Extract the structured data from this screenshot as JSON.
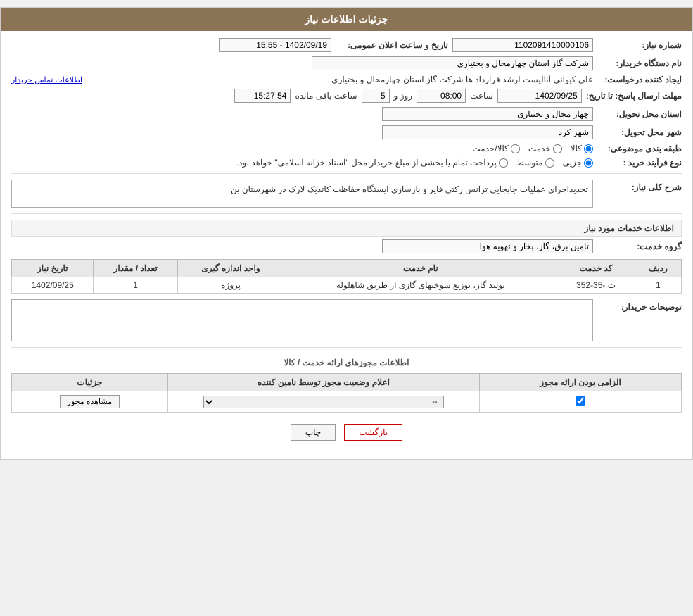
{
  "header": {
    "title": "جزئیات اطلاعات نیاز"
  },
  "fields": {
    "need_number_label": "شماره نیاز:",
    "need_number_value": "1102091410000106",
    "announcement_date_label": "تاریخ و ساعت اعلان عمومی:",
    "announcement_date_value": "1402/09/19 - 15:55",
    "buyer_org_label": "نام دستگاه خریدار:",
    "buyer_org_value": "شرکت گاز استان چهارمحال و بختیاری",
    "creator_label": "ایجاد کننده درخواست:",
    "creator_value": "علی کیوانی آنالیست ارشد قرارداد ها شرکت گاز استان چهارمحال و بختیاری",
    "contact_link": "اطلاعات تماس خریدار",
    "response_deadline_label": "مهلت ارسال پاسخ: تا تاریخ:",
    "deadline_date": "1402/09/25",
    "deadline_time_label": "ساعت",
    "deadline_time": "08:00",
    "deadline_day_label": "روز و",
    "deadline_days": "5",
    "deadline_remaining_label": "ساعت باقی مانده",
    "deadline_remaining": "15:27:54",
    "delivery_province_label": "استان محل تحویل:",
    "delivery_province_value": "چهار محال و بختیاری",
    "delivery_city_label": "شهر محل تحویل:",
    "delivery_city_value": "شهر کرد",
    "category_label": "طبقه بندی موضوعی:",
    "category_options": [
      "کالا",
      "خدمت",
      "کالا/خدمت"
    ],
    "category_selected": "کالا",
    "purchase_type_label": "نوع فرآیند خرید :",
    "purchase_type_options": [
      "جزیی",
      "متوسط",
      "پرداخت تمام یا بخشی از مبلغ خریدار محل \"اسناد خزانه اسلامی\" خواهد بود."
    ],
    "purchase_type_selected": "جزیی",
    "need_description_label": "شرح کلی نیاز:",
    "need_description_value": "تجدیداجرای عملیات جابجایی ترانس رکتی فایر و بازسازی ایستگاه حفاظت کاتدیک لارک در شهرستان بن",
    "services_section_title": "اطلاعات خدمات مورد نیاز",
    "service_group_label": "گروه خدمت:",
    "service_group_value": "تامین برق، گاز، بخار و تهویه هوا",
    "table": {
      "columns": [
        "ردیف",
        "کد خدمت",
        "نام خدمت",
        "واحد اندازه گیری",
        "تعداد / مقدار",
        "تاریخ نیاز"
      ],
      "rows": [
        {
          "row_num": "1",
          "service_code": "ت -35-352",
          "service_name": "تولید گاز، توزیع سوختهای گازی از طریق شاهلوله",
          "unit": "پروژه",
          "quantity": "1",
          "need_date": "1402/09/25"
        }
      ]
    },
    "buyer_notes_label": "توضیحات خریدار:",
    "permits_section_title": "اطلاعات مجوزهای ارائه خدمت / کالا",
    "permits_table": {
      "columns": [
        "الزامی بودن ارائه مجوز",
        "اعلام وضعیت مجوز توسط نامین کننده",
        "جزئیات"
      ],
      "rows": [
        {
          "mandatory": true,
          "status": "--",
          "details_btn": "مشاهده مجوز"
        }
      ]
    }
  },
  "buttons": {
    "print": "چاپ",
    "back": "بازگشت"
  }
}
